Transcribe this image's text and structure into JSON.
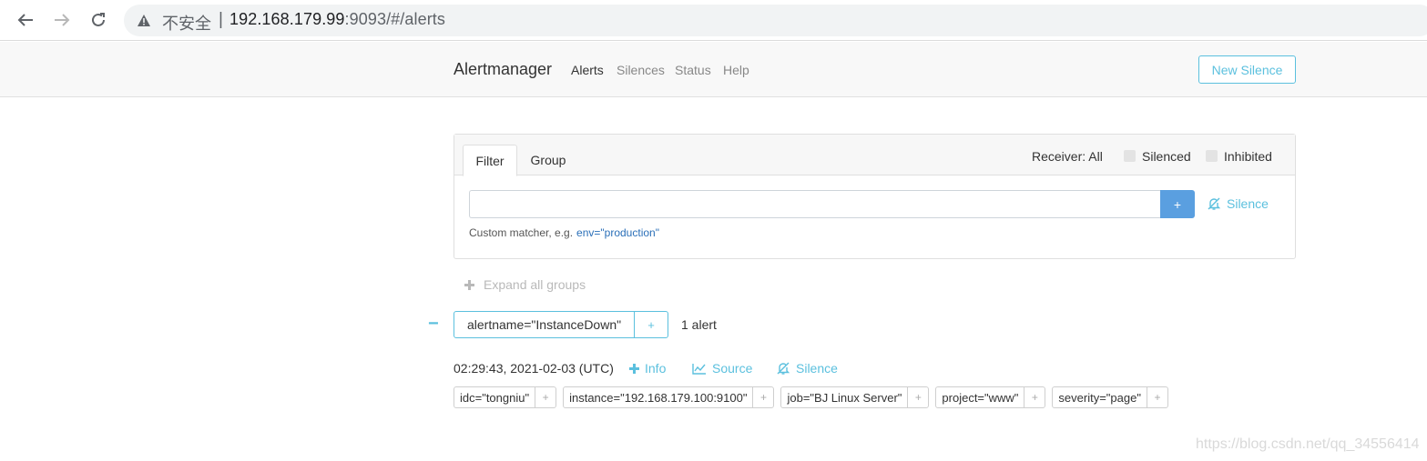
{
  "browser": {
    "insecure_label": "不安全",
    "separator": "|",
    "url_host": "192.168.179.99",
    "url_rest": ":9093/#/alerts"
  },
  "navbar": {
    "brand": "Alertmanager",
    "links": [
      {
        "label": "Alerts",
        "active": true
      },
      {
        "label": "Silences",
        "active": false
      },
      {
        "label": "Status",
        "active": false
      },
      {
        "label": "Help",
        "active": false
      }
    ],
    "new_silence_label": "New Silence"
  },
  "filter_card": {
    "tabs": [
      {
        "label": "Filter",
        "active": true
      },
      {
        "label": "Group",
        "active": false
      }
    ],
    "receiver_label": "Receiver: All",
    "silenced_label": "Silenced",
    "inhibited_label": "Inhibited",
    "input_value": "",
    "add_label": "+",
    "silence_label": "Silence",
    "hint_text": "Custom matcher, e.g.",
    "hint_code": "env=\"production\""
  },
  "groups": {
    "expand_all_label": "Expand all groups",
    "collapse_symbol": "−",
    "group_label": "alertname=\"InstanceDown\"",
    "group_add": "+",
    "alert_count": "1 alert",
    "alert": {
      "time": "02:29:43, 2021-02-03 (UTC)",
      "info_label": "Info",
      "source_label": "Source",
      "silence_label": "Silence",
      "labels": [
        "idc=\"tongniu\"",
        "instance=\"192.168.179.100:9100\"",
        "job=\"BJ Linux Server\"",
        "project=\"www\"",
        "severity=\"page\""
      ],
      "label_add": "+"
    }
  },
  "watermark": "https://blog.csdn.net/qq_34556414",
  "colors": {
    "accent": "#5bc0de",
    "primary_button": "#5a9fe0",
    "link_code": "#2a6fb8"
  }
}
